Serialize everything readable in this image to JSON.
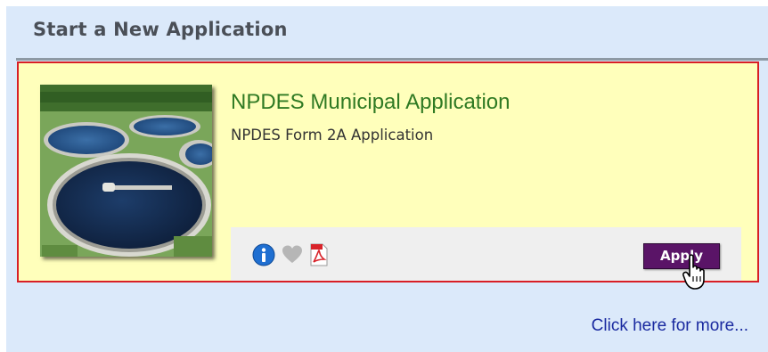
{
  "panel": {
    "title": "Start a New Application",
    "more_link": "Click here for more..."
  },
  "card": {
    "image": "wastewater-treatment-plant-photo",
    "title": "NPDES Municipal Application",
    "subtitle": "NPDES Form 2A Application",
    "icons": [
      "info-icon",
      "heart-icon",
      "pdf-icon"
    ],
    "apply_label": "Apply"
  },
  "colors": {
    "panel_background": "#dbe9fa",
    "card_background": "#ffffbb",
    "card_border": "#d81f26",
    "title_green": "#2f7a23",
    "apply_purple": "#5a1467",
    "link_blue": "#1a2aa0"
  }
}
